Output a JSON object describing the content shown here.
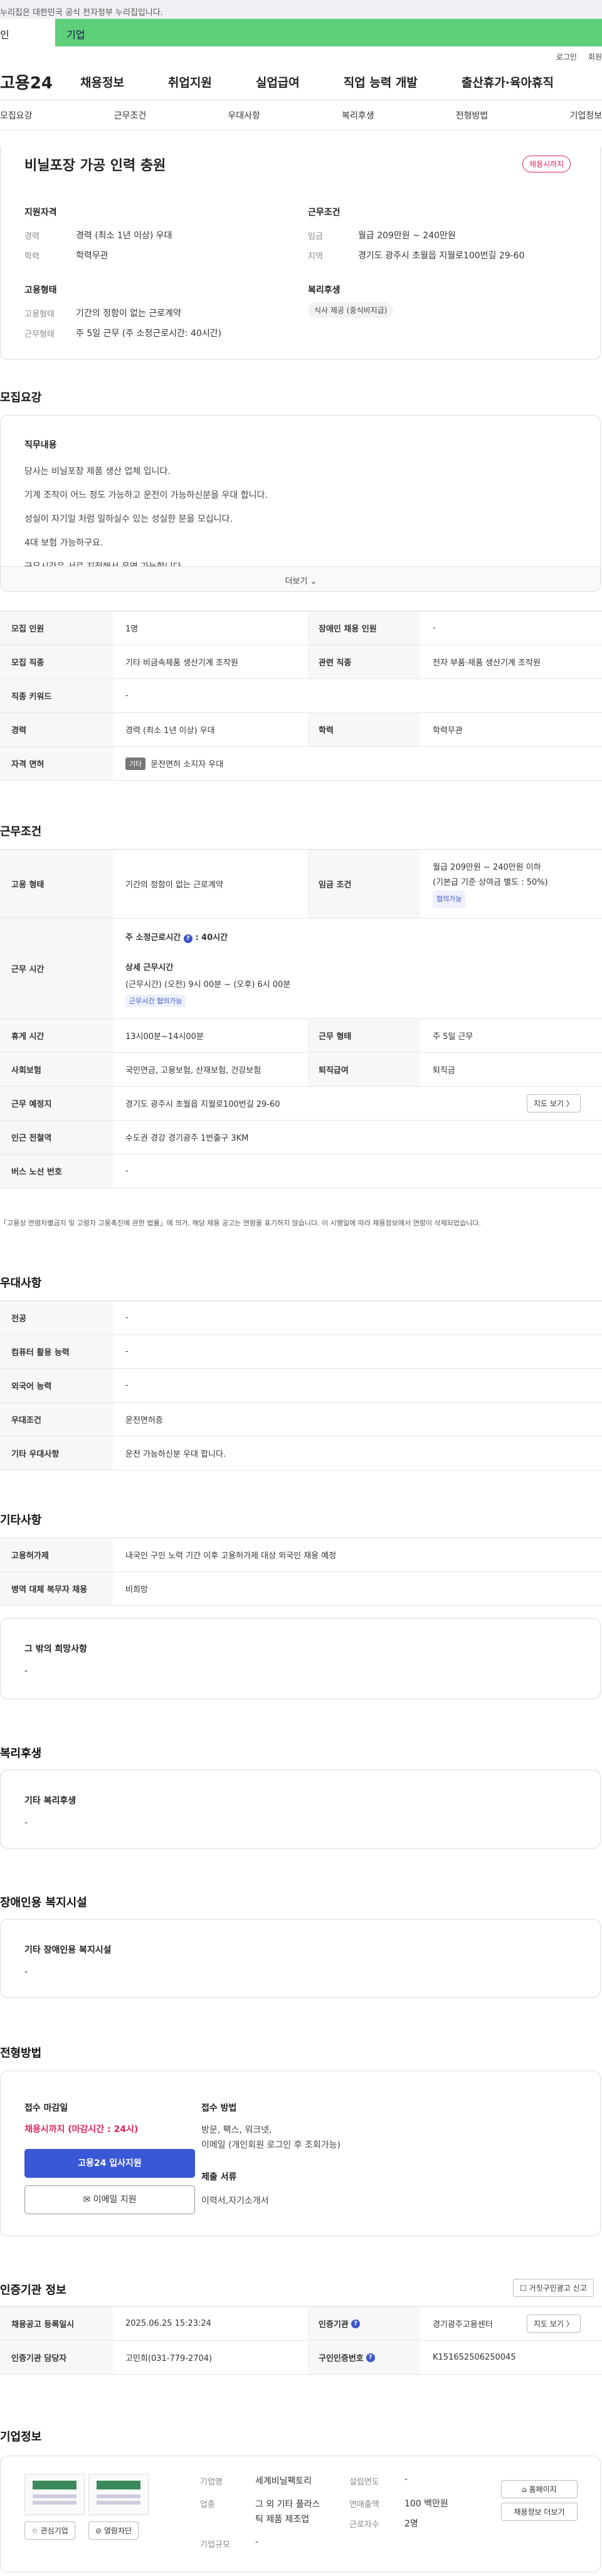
{
  "gov_notice": "누리집은 대한민국 공식 전자정부 누리집입니다.",
  "top_tabs": [
    "인",
    "기업"
  ],
  "util": [
    "로그인",
    "회원"
  ],
  "brand": "고용24",
  "gnb": [
    "채용정보",
    "취업지원",
    "실업급여",
    "직업 능력 개발",
    "출산휴가·육아휴직"
  ],
  "snb": [
    "모집요강",
    "근무조건",
    "우대사항",
    "복리후생",
    "전형방법",
    "기업정보"
  ],
  "job_title": "비닐포장 가공 인력 충원",
  "status_badge": "채용시까지",
  "summary": {
    "qual_title": "지원자격",
    "career_label": "경력",
    "career_value": "경력 (최소 1년 이상) 우대",
    "edu_label": "학력",
    "edu_value": "학력무관",
    "emp_title": "고용형태",
    "emptype_label": "고용형태",
    "emptype_value": "기간의 정함이 없는 근로계약",
    "worktype_label": "근무형태",
    "worktype_value": "주 5일 근무 (주 소정근로시간: 40시간)",
    "cond_title": "근무조건",
    "wage_label": "임금",
    "wage_value": "월급 209만원 ~ 240만원",
    "region_label": "지역",
    "region_value": "경기도 광주시 초월읍 지월로100번길 29-60",
    "welfare_title": "복리후생",
    "welfare_chip": "식사 제공 (중식비지급)"
  },
  "recruit": {
    "title": "모집요강",
    "job_content_title": "직무내용",
    "lines": [
      "당사는 비닐포장 제품 생산 업체 입니다.",
      "기계 조작이 어느 정도 가능하고 운전이 가능하신분을 우대 합니다.",
      "성실이 자기일 처럼 일하실수 있는 성실한 분을 모십니다.",
      "4대 보험 가능하구요.",
      "근무시간은 서로 지정해서 운영 가능합니다."
    ],
    "more_label": "더보기",
    "rows": [
      {
        "k1": "모집 인원",
        "v1": "1명",
        "k2": "장애인 채용 인원",
        "v2": "-"
      },
      {
        "k1": "모집 직종",
        "v1": "기타 비금속제품 생산기계 조작원",
        "k2": "관련 직종",
        "v2": "전자 부품·제품 생산기계 조작원"
      },
      {
        "k1": "직종 키워드",
        "v1": "-"
      },
      {
        "k1": "경력",
        "v1": "경력 (최소 1년 이상) 우대",
        "k2": "학력",
        "v2": "학력무관"
      },
      {
        "k1": "자격 면허",
        "v1": "운전면허 소지자 우대",
        "chip": "기타"
      }
    ]
  },
  "conditions": {
    "title": "근무조건",
    "emp_label": "고용 형태",
    "emp_value": "기간의 정함이 없는 근로계약",
    "wage_label": "임금 조건",
    "wage_value": "월급 209만원 ~ 240만원 이하",
    "wage_note": "(기본급 기준 상여금 별도 : 50%)",
    "wage_chip": "협의가능",
    "hours_label": "근무 시간",
    "weekly_hours_label": "주 소정근로시간",
    "weekly_hours_value": ": 40시간",
    "detail_hours_title": "상세 근무시간",
    "detail_hours_value": "(근무시간) (오전) 9시 00분 ~ (오후) 6시 00분",
    "hours_chip": "근무시간 협의가능",
    "rest_label": "휴게 시간",
    "rest_value": "13시00분~14시00분",
    "shift_label": "근무 형태",
    "shift_value": "주 5일 근무",
    "insurance_label": "사회보험",
    "insurance_value": "국민연금, 고용보험, 산재보험, 건강보험",
    "severance_label": "퇴직급여",
    "severance_value": "퇴직금",
    "place_label": "근무 예정지",
    "place_value": "경기도 광주시 초월읍 지월로100번길 29-60",
    "map_button": "지도 보기",
    "station_label": "인근 전철역",
    "station_value": "수도권 경강 경기광주 1번출구 3KM",
    "bus_label": "버스 노선 번호",
    "bus_value": "-",
    "footnote": "「고용상 연령차별금지 및 고령자 고용촉진에 관한 법률」에 의거, 해당 채용 공고는 연령을 표기하지 않습니다. 이 시행일에 따라 채용정보에서 연령이 삭제되었습니다."
  },
  "preferences": {
    "title": "우대사항",
    "rows": [
      {
        "k": "전공",
        "v": "-"
      },
      {
        "k": "컴퓨터 활용 능력",
        "v": "-"
      },
      {
        "k": "외국어 능력",
        "v": "-"
      },
      {
        "k": "우대조건",
        "v": "운전면허증"
      },
      {
        "k": "기타 우대사항",
        "v": "운전 가능하신분 우대 합니다."
      }
    ]
  },
  "etc": {
    "title": "기타사항",
    "rows": [
      {
        "k": "고용허가제",
        "v": "내국인 구인 노력 기간 이후 고용허가제 대상 외국인 채용 예정"
      },
      {
        "k": "병역 대체 복무자 채용",
        "v": "비희망"
      }
    ],
    "other_title": "그 밖의 희망사항",
    "other_value": "-"
  },
  "welfare": {
    "title": "복리후생",
    "box_title": "기타 복리후생",
    "box_value": "-"
  },
  "disability": {
    "title": "장애인용 복지시설",
    "box_title": "기타 장애인용 복지시설",
    "box_value": "-"
  },
  "selection": {
    "title": "전형방법",
    "deadline_title": "접수 마감일",
    "deadline_value": "채용시까지 (마감시간 : 24시)",
    "apply_button": "고용24 입사지원",
    "email_button": "이메일 지원",
    "method_title": "접수 방법",
    "method_value_1": "방문, 팩스, 워크넷,",
    "method_value_2": "이메일 (개인회원 로그인 후 조회가능)",
    "docs_title": "제출 서류",
    "docs_value": "이력서,자기소개서"
  },
  "agency": {
    "title": "인증기관 정보",
    "report_button": "거짓구인광고 신고",
    "rows": [
      {
        "k1": "채용공고 등록일시",
        "v1": "2025.06.25 15:23:24",
        "k2": "인증기관",
        "v2": "경기광주고용센터",
        "btn": "지도 보기"
      },
      {
        "k1": "인증기관 담당자",
        "v1": "고민희(031-779-2704)",
        "k2": "구인인증번호",
        "v2": "K151652506250045"
      }
    ]
  },
  "company": {
    "title": "기업정보",
    "interest_button": "관심기업",
    "view_button": "열람차단",
    "name_label": "기업명",
    "name_value": "세계비닐팩토리",
    "industry_label": "업종",
    "industry_value_1": "그 외 기타 플라스",
    "industry_value_2": "틱 제품 제조업",
    "scale_label": "기업규모",
    "scale_value": "-",
    "founded_label": "설립연도",
    "founded_value": "-",
    "sales_label": "연매출액",
    "sales_value": "100 백만원",
    "staff_label": "근로자수",
    "staff_value": "2명",
    "homepage_button": "홈페이지",
    "jobs_button": "채용정보 더보기"
  }
}
